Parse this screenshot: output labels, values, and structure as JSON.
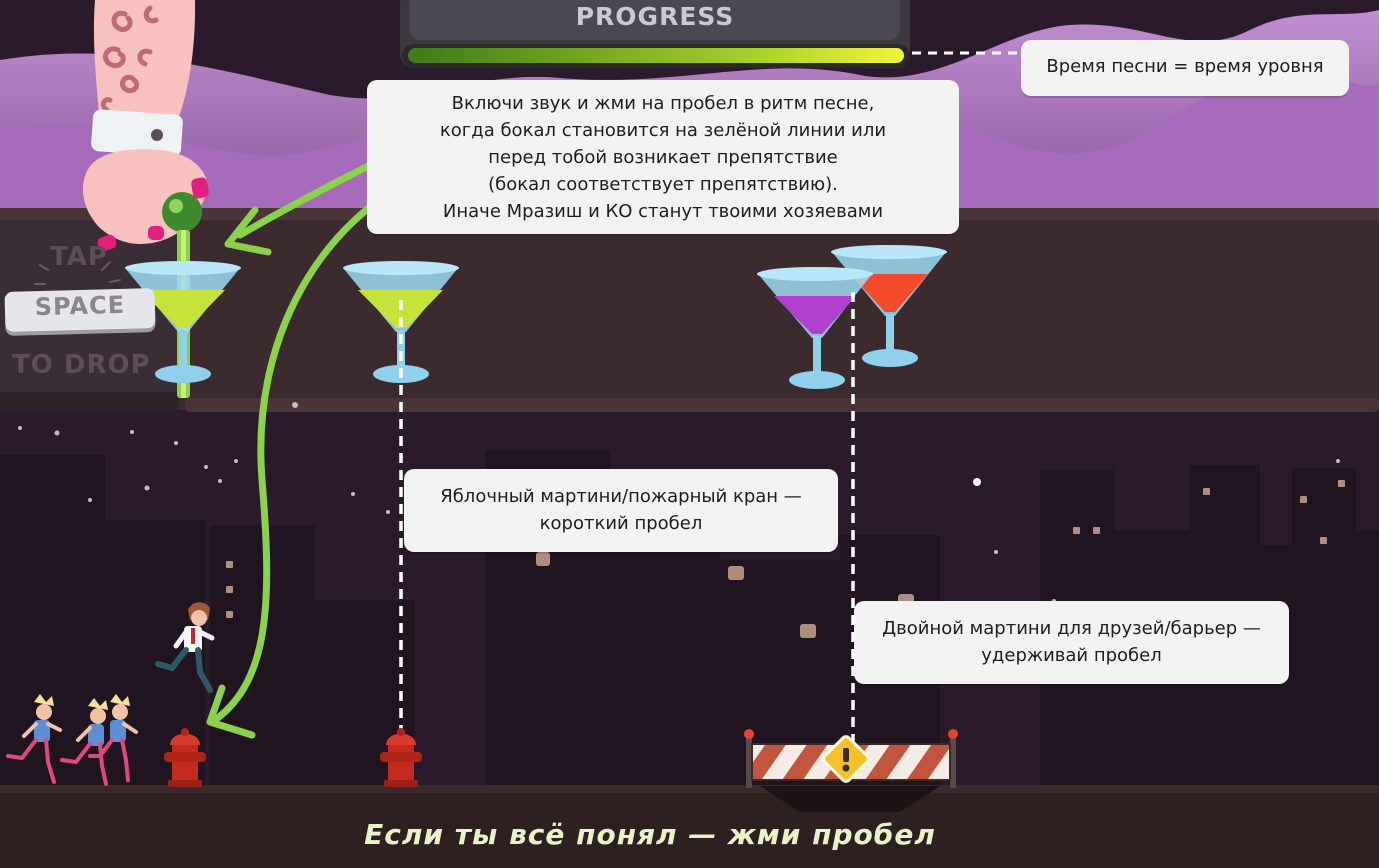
{
  "progress": {
    "label": "PROGRESS",
    "fill_fraction": 1.0,
    "bar_color": "#d8e830"
  },
  "tap_hint": {
    "line1": "TAP",
    "key": "SPACE",
    "line2": "TO DROP"
  },
  "callouts": {
    "song_time": "Время песни = время уровня",
    "main_instructions": [
      "Включи звук и жми на пробел в ритм песне,",
      "когда бокал становится на зелёной линии или",
      "перед тобой возникает препятствие",
      "(бокал соответствует препятствию).",
      "Иначе Мразиш и КО станут твоими хозяевами"
    ],
    "apple_martini": [
      "Яблочный мартини/пожарный кран —",
      "короткий пробел"
    ],
    "double_martini": [
      "Двойной мартини для друзей/барьер —",
      "удерживай пробел"
    ]
  },
  "bottom_hint": "Если ты всё понял — жми пробел",
  "colors": {
    "sky": "#2b1a2c",
    "hills": "#b77fc7",
    "bar_shelf": "#3a2a2e",
    "ground": "#2e1f20",
    "green_guide": "#8ad24a",
    "apple_drink": "#c6e33a",
    "purple_drink": "#b23fd0",
    "red_drink": "#f24a2a"
  },
  "icons": {
    "hand": "hand-with-olive-icon",
    "glass": "martini-glass-icon",
    "hydrant": "fire-hydrant-icon",
    "barrier": "road-barrier-icon",
    "warning": "warning-sign-icon",
    "runner": "running-man-icon",
    "chasers": "chasing-girls-icon"
  }
}
